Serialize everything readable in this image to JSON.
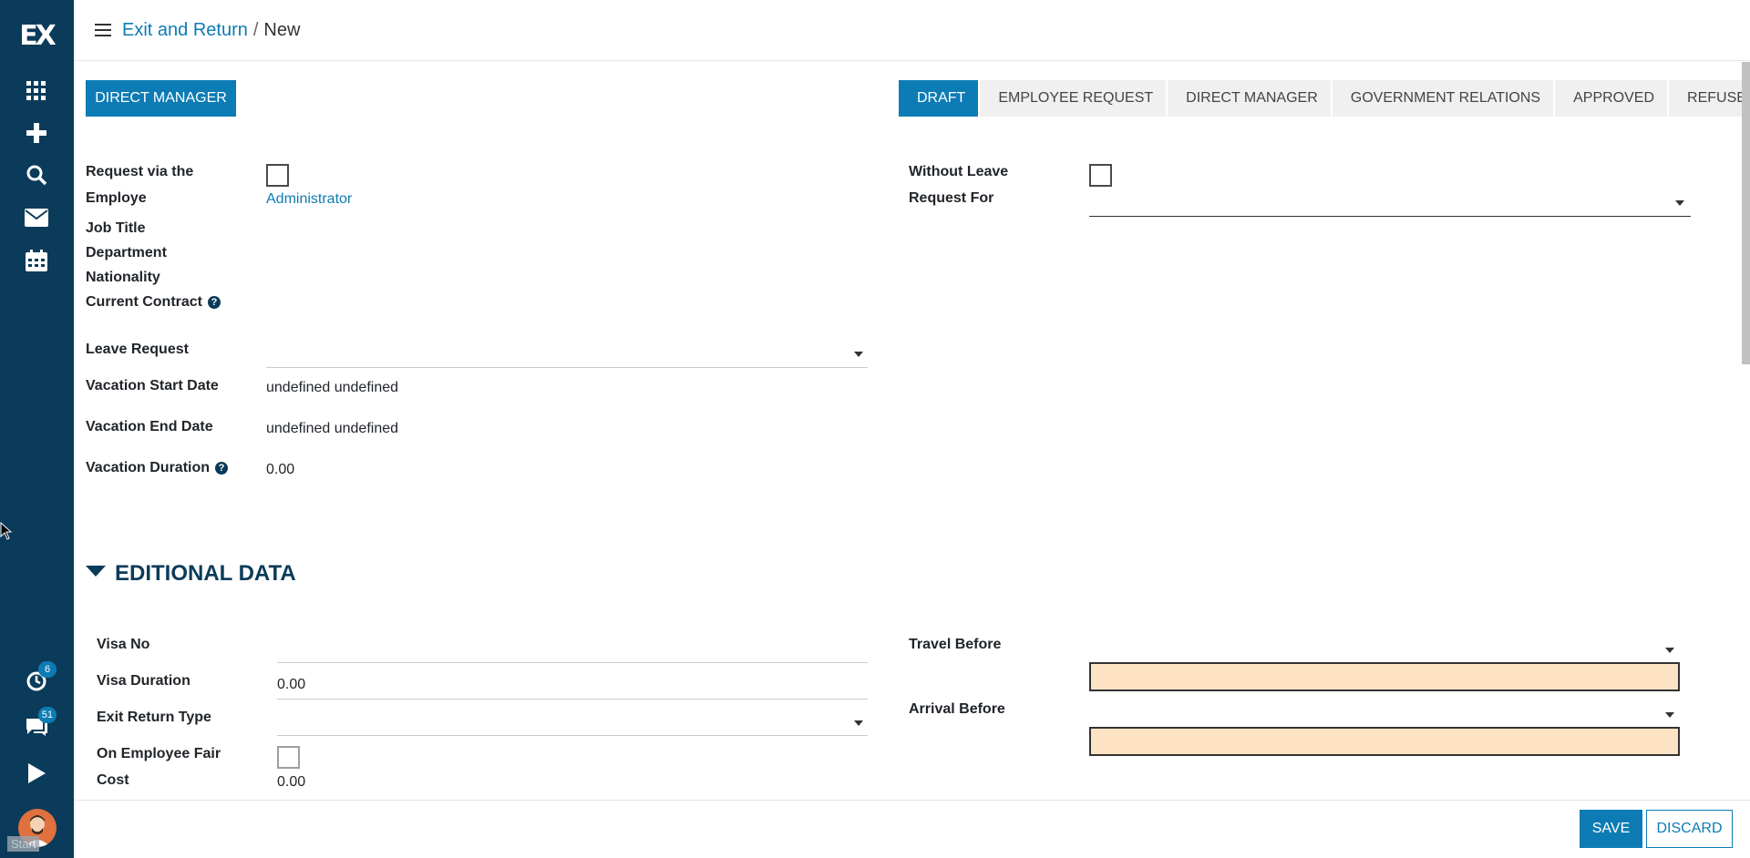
{
  "sidebar": {
    "logo": "EX",
    "icons": [
      "apps-grid-icon",
      "plus-icon",
      "search-icon",
      "mail-icon",
      "calendar-icon"
    ],
    "activity_badge": "6",
    "chat_badge": "51",
    "start_label": "Start"
  },
  "header": {
    "breadcrumb_parent": "Exit and Return",
    "breadcrumb_separator": "/",
    "breadcrumb_current": "New"
  },
  "actions": {
    "direct_manager_button": "DIRECT MANAGER",
    "save": "SAVE",
    "discard": "DISCARD"
  },
  "status_stages": [
    "DRAFT",
    "EMPLOYEE REQUEST",
    "DIRECT MANAGER",
    "GOVERNMENT RELATIONS",
    "APPROVED",
    "REFUSE"
  ],
  "active_stage": "DRAFT",
  "form": {
    "request_via_label": "Request via the",
    "employe_label": "Employe",
    "employe_value": "Administrator",
    "job_title_label": "Job Title",
    "department_label": "Department",
    "nationality_label": "Nationality",
    "current_contract_label": "Current Contract",
    "leave_request_label": "Leave Request",
    "vacation_start_label": "Vacation Start Date",
    "vacation_start_value": "undefined undefined",
    "vacation_end_label": "Vacation End Date",
    "vacation_end_value": "undefined undefined",
    "vacation_duration_label": "Vacation Duration",
    "vacation_duration_value": "0.00",
    "without_leave_label": "Without Leave",
    "request_for_label": "Request For",
    "help_glyph": "?"
  },
  "section": {
    "title": "EDITIONAL DATA",
    "visa_no_label": "Visa No",
    "visa_duration_label": "Visa Duration",
    "visa_duration_value": "0.00",
    "exit_return_type_label": "Exit Return Type",
    "on_employee_fair_label": "On Employee Fair",
    "cost_label": "Cost",
    "cost_value": "0.00",
    "travel_before_label": "Travel Before",
    "arrival_before_label": "Arrival Before"
  },
  "colors": {
    "sidebar": "#0b3b5a",
    "accent": "#0d7cb4",
    "required_field": "#fde2c4"
  }
}
